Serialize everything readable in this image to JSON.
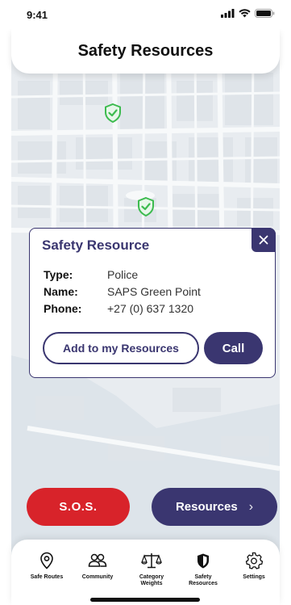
{
  "status_bar": {
    "time": "9:41"
  },
  "header": {
    "title": "Safety Resources"
  },
  "map": {
    "pin_icon": "shield-check-icon",
    "pin_color": "#3dbb4f"
  },
  "popup": {
    "title": "Safety Resource",
    "close_icon": "close-icon",
    "rows": [
      {
        "label": "Type:",
        "value": "Police"
      },
      {
        "label": "Name:",
        "value": "SAPS Green Point"
      },
      {
        "label": "Phone:",
        "value": "+27 (0) 637 1320"
      }
    ],
    "add_button": "Add to my Resources",
    "call_button": "Call"
  },
  "actions": {
    "sos_label": "S.O.S.",
    "resources_label": "Resources",
    "resources_chevron": "›"
  },
  "nav": {
    "items": [
      {
        "label": "Safe Routes",
        "icon": "location-pin-icon"
      },
      {
        "label": "Community",
        "icon": "people-icon"
      },
      {
        "label": "Category\nWeights",
        "icon": "scales-icon"
      },
      {
        "label": "Safety\nResources",
        "icon": "shield-icon"
      },
      {
        "label": "Settings",
        "icon": "gear-icon"
      }
    ]
  },
  "colors": {
    "primary": "#3a3670",
    "sos": "#d8232a",
    "map_bg": "#e9edf1"
  }
}
